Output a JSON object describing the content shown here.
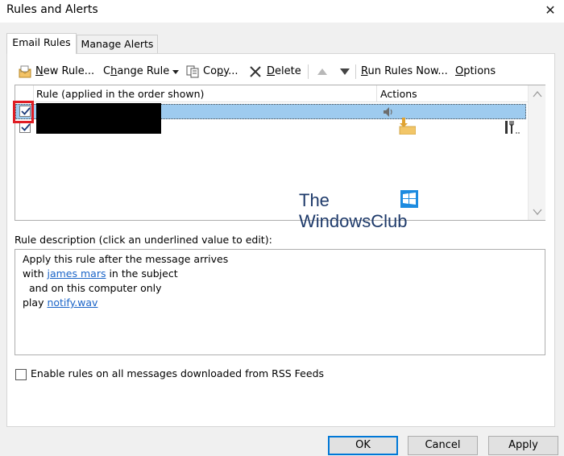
{
  "window": {
    "title": "Rules and Alerts",
    "close_glyph": "✕"
  },
  "tabs": [
    {
      "label": "Email Rules",
      "active": true
    },
    {
      "label": "Manage Alerts",
      "active": false
    }
  ],
  "toolbar": {
    "new_rule": {
      "u": "N",
      "rest": "ew Rule..."
    },
    "change_rule": {
      "pre": "C",
      "u": "h",
      "rest": "ange Rule"
    },
    "copy": {
      "pre": "Co",
      "u": "p",
      "rest": "y..."
    },
    "delete": {
      "u": "D",
      "rest": "elete"
    },
    "run_rules": {
      "u": "R",
      "rest": "un Rules Now..."
    },
    "options": {
      "u": "O",
      "rest": "ptions"
    }
  },
  "rules_table": {
    "columns": [
      "Rule (applied in the order shown)",
      "Actions"
    ],
    "rows": [
      {
        "checked": true,
        "selected": true,
        "name_redacted": true,
        "action_icons": [
          "speaker-icon"
        ]
      },
      {
        "checked": true,
        "selected": false,
        "name_redacted": true,
        "action_icons": [
          "move-to-folder-icon",
          "custom-action-icon"
        ]
      }
    ]
  },
  "watermark": {
    "line1": "The",
    "line2": "WindowsClub",
    "logo_color": "#1c8be0"
  },
  "description": {
    "label": "Rule description (click an underlined value to edit):",
    "line1": "Apply this rule after the message arrives",
    "line2_pre": "with ",
    "line2_link": "james mars",
    "line2_post": " in the subject",
    "line3": "and on this computer only",
    "line4_pre": "play ",
    "line4_link": "notify.wav"
  },
  "rss": {
    "label": "Enable rules on all messages downloaded from RSS Feeds",
    "checked": false
  },
  "buttons": {
    "ok": "OK",
    "cancel": "Cancel",
    "apply": "Apply"
  },
  "colors": {
    "selection": "#9ecbef",
    "highlight_box": "#e01d24",
    "link": "#1a64c8",
    "ok_border": "#0078d7"
  }
}
